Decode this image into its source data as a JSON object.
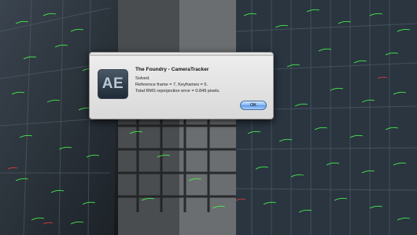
{
  "dialog": {
    "app_icon_text": "AE",
    "title": "The Foundry - CameraTracker",
    "status": "Solved.",
    "reference_line": "Reference frame = 7, Keyframes = 5.",
    "error_line": "Total RMS reprojection error = 0.849 pixels.",
    "ok_label": "OK"
  },
  "colors": {
    "track_green": "#47ff4a",
    "track_red": "#ff3b3b",
    "ok_button": "#7fb2f0"
  }
}
